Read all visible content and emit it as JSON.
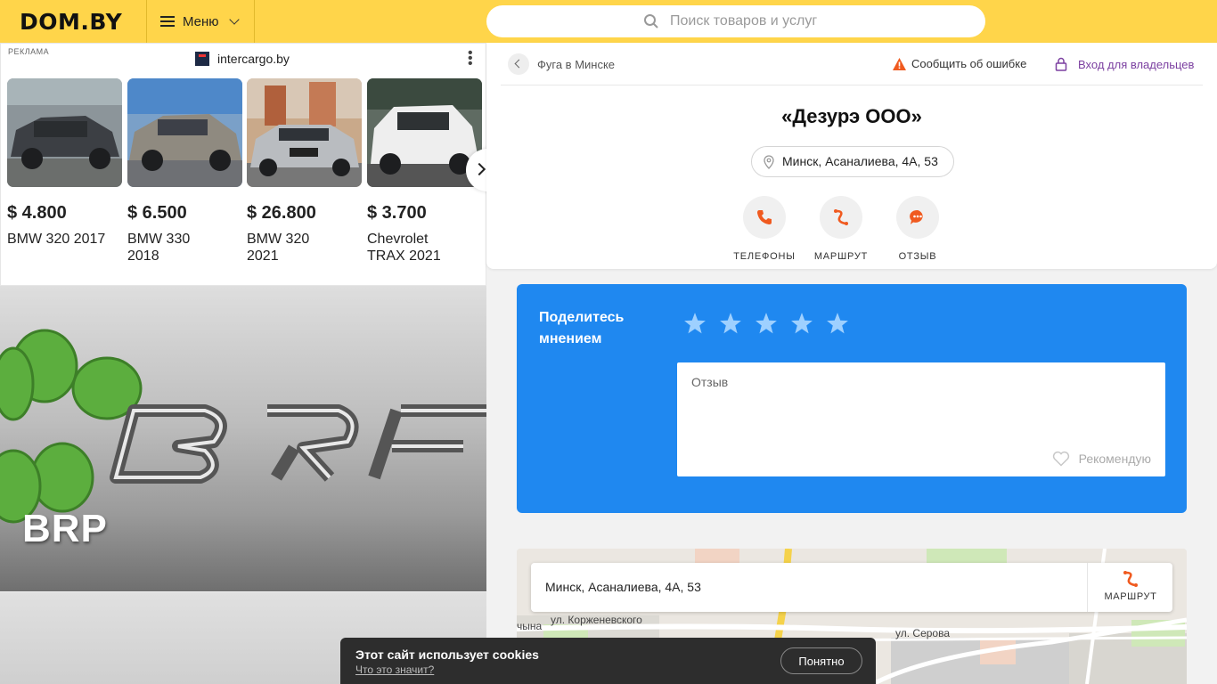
{
  "header": {
    "logo": "DOM.BY",
    "menu_label": "Меню",
    "search_placeholder": "Поиск товаров и услуг"
  },
  "ad": {
    "tag": "РЕКЛАМА",
    "source": "intercargo.by",
    "cards": [
      {
        "price": "$ 4.800",
        "name": "BMW 320 2017"
      },
      {
        "price": "$ 6.500",
        "name": "BMW 330 2018"
      },
      {
        "price": "$ 26.800",
        "name": "BMW 320 2021"
      },
      {
        "price": "$ 3.700",
        "name": "Chevrolet TRAX 2021"
      }
    ]
  },
  "banner": {
    "title": "BRP"
  },
  "company": {
    "breadcrumb": "Фуга в Минске",
    "report_label": "Сообщить об ошибке",
    "owner_label": "Вход для владельцев",
    "name": "«Дезурэ ООО»",
    "address": "Минск, Асаналиева, 4А, 53",
    "actions": [
      {
        "label": "ТЕЛЕФОНЫ",
        "icon": "phone-icon"
      },
      {
        "label": "МАРШРУТ",
        "icon": "route-icon"
      },
      {
        "label": "ОТЗЫВ",
        "icon": "chat-icon"
      }
    ]
  },
  "review": {
    "title": "Поделитесь мнением",
    "placeholder": "Отзыв",
    "recommend_label": "Рекомендую",
    "stars_total": 5
  },
  "map": {
    "address": "Минск, Асаналиева, 4А, 53",
    "route_label": "МАРШРУТ",
    "streets": [
      "ул. Корженевского",
      "ул. Серова",
      "чына"
    ]
  },
  "cookie": {
    "text": "Этот сайт использует cookies",
    "link": "Что это значит?",
    "button": "Понятно"
  },
  "colors": {
    "header_bg": "#ffd54a",
    "accent_orange": "#f05a1f",
    "review_bg": "#1f88f0",
    "owner_link": "#7b3fa0"
  }
}
